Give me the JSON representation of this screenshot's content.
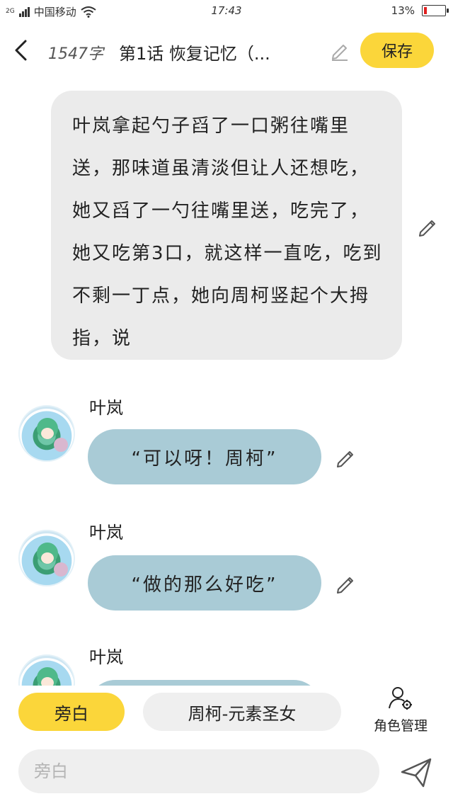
{
  "status_bar": {
    "network": "2G",
    "carrier": "中国移动",
    "time": "17:43",
    "battery": "13%",
    "battery_level": 0.13
  },
  "header": {
    "word_count": "1547字",
    "chapter_title": "第1话  恢复记忆（...",
    "save_label": "保存"
  },
  "narration": {
    "text": "叶岚拿起勺子舀了一口粥往嘴里送，那味道虽清淡但让人还想吃，她又舀了一勺往嘴里送，吃完了，她又吃第3口，就这样一直吃，吃到不剩一丁点，她向周柯竖起个大拇指，说"
  },
  "messages": [
    {
      "speaker": "叶岚",
      "text": "“可以呀！周柯”"
    },
    {
      "speaker": "叶岚",
      "text": "“做的那么好吃”"
    },
    {
      "speaker": "叶岚",
      "text": ""
    }
  ],
  "roles": {
    "narrator_label": "旁白",
    "character_label": "周柯-元素圣女",
    "manage_label": "角色管理"
  },
  "composer": {
    "placeholder": "旁白"
  },
  "colors": {
    "accent_yellow": "#fbd63a",
    "bubble_blue": "#a9cbd6",
    "narration_gray": "#ebebeb"
  },
  "icons": [
    "back-arrow-icon",
    "pencil-icon",
    "role-manage-icon",
    "send-icon"
  ]
}
